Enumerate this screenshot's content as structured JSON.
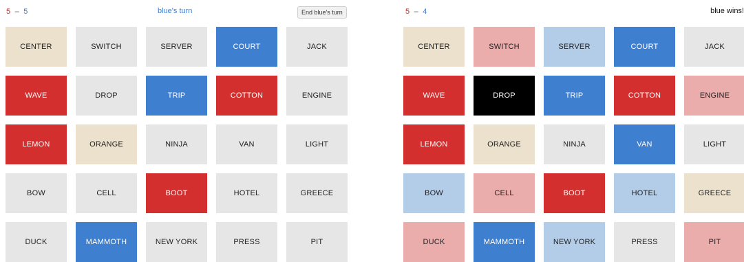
{
  "left": {
    "score": {
      "red": "5",
      "separator": "–",
      "blue": "5"
    },
    "turn_text": "blue's turn",
    "end_turn_button": "End blue's turn",
    "cards": [
      {
        "word": "CENTER",
        "state": "beige"
      },
      {
        "word": "SWITCH",
        "state": "neutral"
      },
      {
        "word": "SERVER",
        "state": "neutral"
      },
      {
        "word": "COURT",
        "state": "blue"
      },
      {
        "word": "JACK",
        "state": "neutral"
      },
      {
        "word": "WAVE",
        "state": "red"
      },
      {
        "word": "DROP",
        "state": "neutral"
      },
      {
        "word": "TRIP",
        "state": "blue"
      },
      {
        "word": "COTTON",
        "state": "red"
      },
      {
        "word": "ENGINE",
        "state": "neutral"
      },
      {
        "word": "LEMON",
        "state": "red"
      },
      {
        "word": "ORANGE",
        "state": "beige"
      },
      {
        "word": "NINJA",
        "state": "neutral"
      },
      {
        "word": "VAN",
        "state": "neutral"
      },
      {
        "word": "LIGHT",
        "state": "neutral"
      },
      {
        "word": "BOW",
        "state": "neutral"
      },
      {
        "word": "CELL",
        "state": "neutral"
      },
      {
        "word": "BOOT",
        "state": "red"
      },
      {
        "word": "HOTEL",
        "state": "neutral"
      },
      {
        "word": "GREECE",
        "state": "neutral"
      },
      {
        "word": "DUCK",
        "state": "neutral"
      },
      {
        "word": "MAMMOTH",
        "state": "blue"
      },
      {
        "word": "NEW YORK",
        "state": "neutral"
      },
      {
        "word": "PRESS",
        "state": "neutral"
      },
      {
        "word": "PIT",
        "state": "neutral"
      }
    ]
  },
  "right": {
    "score": {
      "red": "5",
      "separator": "–",
      "blue": "4"
    },
    "result_text": "blue wins!",
    "cards": [
      {
        "word": "CENTER",
        "state": "beige"
      },
      {
        "word": "SWITCH",
        "state": "pink"
      },
      {
        "word": "SERVER",
        "state": "lightblue"
      },
      {
        "word": "COURT",
        "state": "blue"
      },
      {
        "word": "JACK",
        "state": "neutral"
      },
      {
        "word": "WAVE",
        "state": "red"
      },
      {
        "word": "DROP",
        "state": "black"
      },
      {
        "word": "TRIP",
        "state": "blue"
      },
      {
        "word": "COTTON",
        "state": "red"
      },
      {
        "word": "ENGINE",
        "state": "pink"
      },
      {
        "word": "LEMON",
        "state": "red"
      },
      {
        "word": "ORANGE",
        "state": "beige"
      },
      {
        "word": "NINJA",
        "state": "neutral"
      },
      {
        "word": "VAN",
        "state": "blue"
      },
      {
        "word": "LIGHT",
        "state": "neutral"
      },
      {
        "word": "BOW",
        "state": "lightblue"
      },
      {
        "word": "CELL",
        "state": "pink"
      },
      {
        "word": "BOOT",
        "state": "red"
      },
      {
        "word": "HOTEL",
        "state": "lightblue"
      },
      {
        "word": "GREECE",
        "state": "beige"
      },
      {
        "word": "DUCK",
        "state": "pink"
      },
      {
        "word": "MAMMOTH",
        "state": "blue"
      },
      {
        "word": "NEW YORK",
        "state": "lightblue"
      },
      {
        "word": "PRESS",
        "state": "neutral"
      },
      {
        "word": "PIT",
        "state": "pink"
      }
    ]
  },
  "colors": {
    "red": "#d32f2f",
    "blue": "#3f7fd0",
    "beige": "#ece1cd",
    "neutral": "#e6e6e6",
    "pink": "#ebacac",
    "lightblue": "#b3cde9",
    "black": "#000000"
  }
}
